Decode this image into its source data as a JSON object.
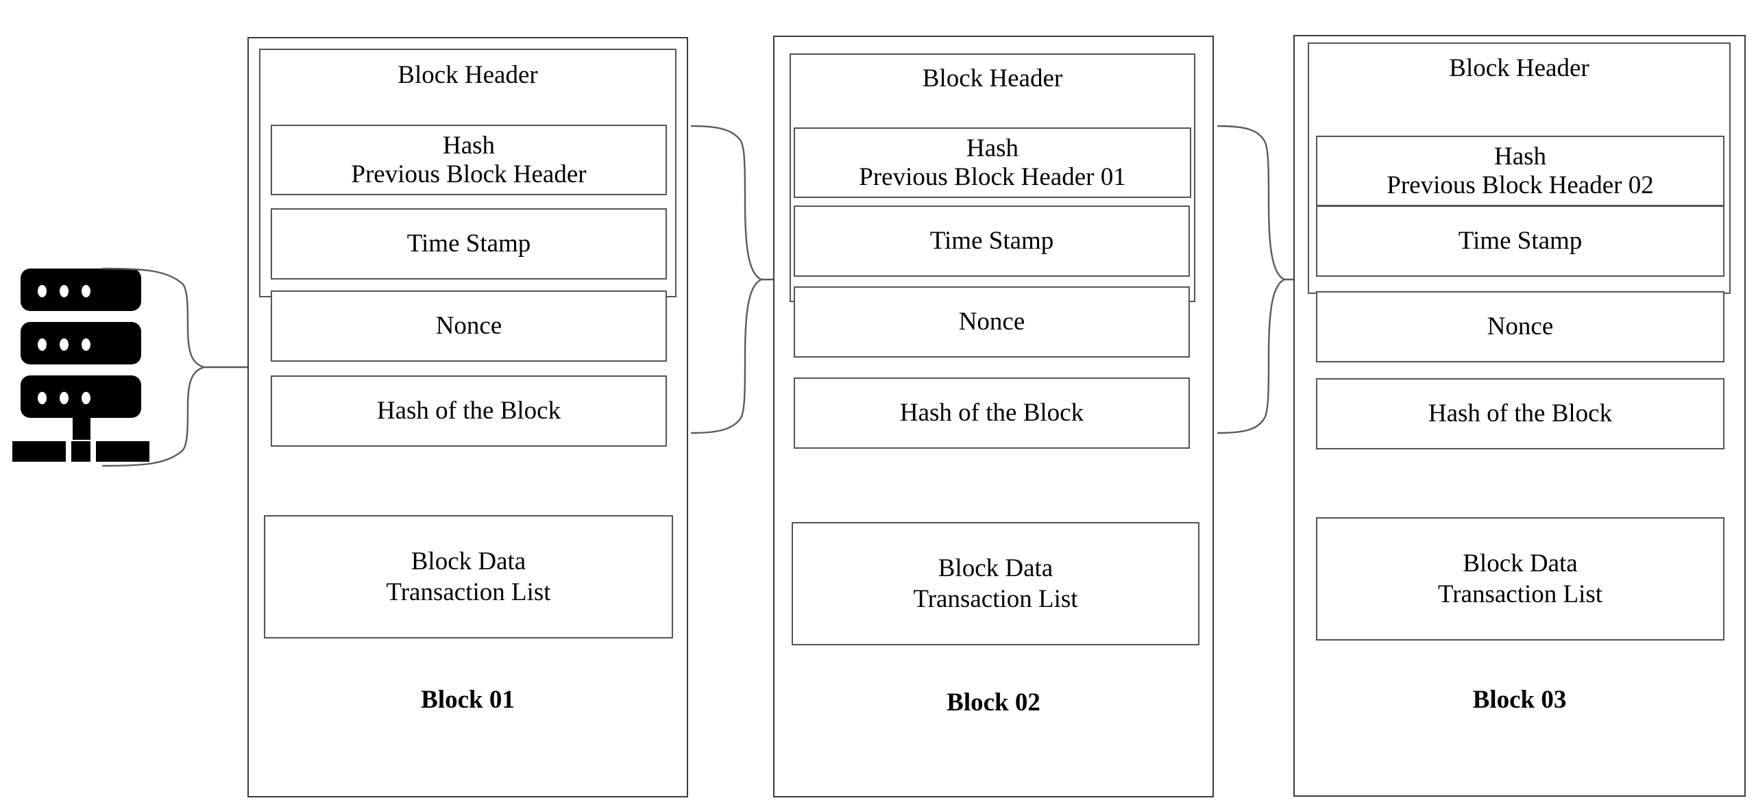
{
  "diagram": {
    "title": "Blockchain Block Structure",
    "node_icon": "server-stack-icon",
    "line_color": "#545454",
    "outer_border_color": "#3a3a3a",
    "icon_color": "#000000",
    "background": "#ffffff"
  },
  "connectors": [
    {
      "name": "brace-node-to-block01",
      "style": "curly-brace",
      "from": "server-stack",
      "to": "block-01"
    },
    {
      "name": "brace-block01-to-block02",
      "style": "curly-brace",
      "from": "block-01",
      "to": "block-02"
    },
    {
      "name": "brace-block02-to-block03",
      "style": "curly-brace",
      "from": "block-02",
      "to": "block-03"
    }
  ],
  "blocks": [
    {
      "header_title": "Block Header",
      "fields": [
        {
          "name": "hash-previous-block-header",
          "line1": "Hash",
          "line2": "Previous Block Header"
        },
        {
          "name": "time-stamp",
          "line1": "Time Stamp",
          "line2": ""
        },
        {
          "name": "nonce",
          "line1": "Nonce",
          "line2": ""
        },
        {
          "name": "hash-of-the-block",
          "line1": "Hash of the Block",
          "line2": ""
        }
      ],
      "data": {
        "line1": "Block Data",
        "line2": "Transaction List"
      },
      "caption": "Block 01"
    },
    {
      "header_title": "Block Header",
      "fields": [
        {
          "name": "hash-previous-block-header",
          "line1": "Hash",
          "line2": "Previous Block Header 01"
        },
        {
          "name": "time-stamp",
          "line1": "Time Stamp",
          "line2": ""
        },
        {
          "name": "nonce",
          "line1": "Nonce",
          "line2": ""
        },
        {
          "name": "hash-of-the-block",
          "line1": "Hash of the Block",
          "line2": ""
        }
      ],
      "data": {
        "line1": "Block Data",
        "line2": "Transaction List"
      },
      "caption": "Block 02"
    },
    {
      "header_title": "Block Header",
      "fields": [
        {
          "name": "hash-previous-block-header",
          "line1": "Hash",
          "line2": "Previous Block Header 02"
        },
        {
          "name": "time-stamp",
          "line1": "Time Stamp",
          "line2": ""
        },
        {
          "name": "nonce",
          "line1": "Nonce",
          "line2": ""
        },
        {
          "name": "hash-of-the-block",
          "line1": "Hash of the Block",
          "line2": ""
        }
      ],
      "data": {
        "line1": "Block Data",
        "line2": "Transaction List"
      },
      "caption": "Block 03"
    }
  ]
}
